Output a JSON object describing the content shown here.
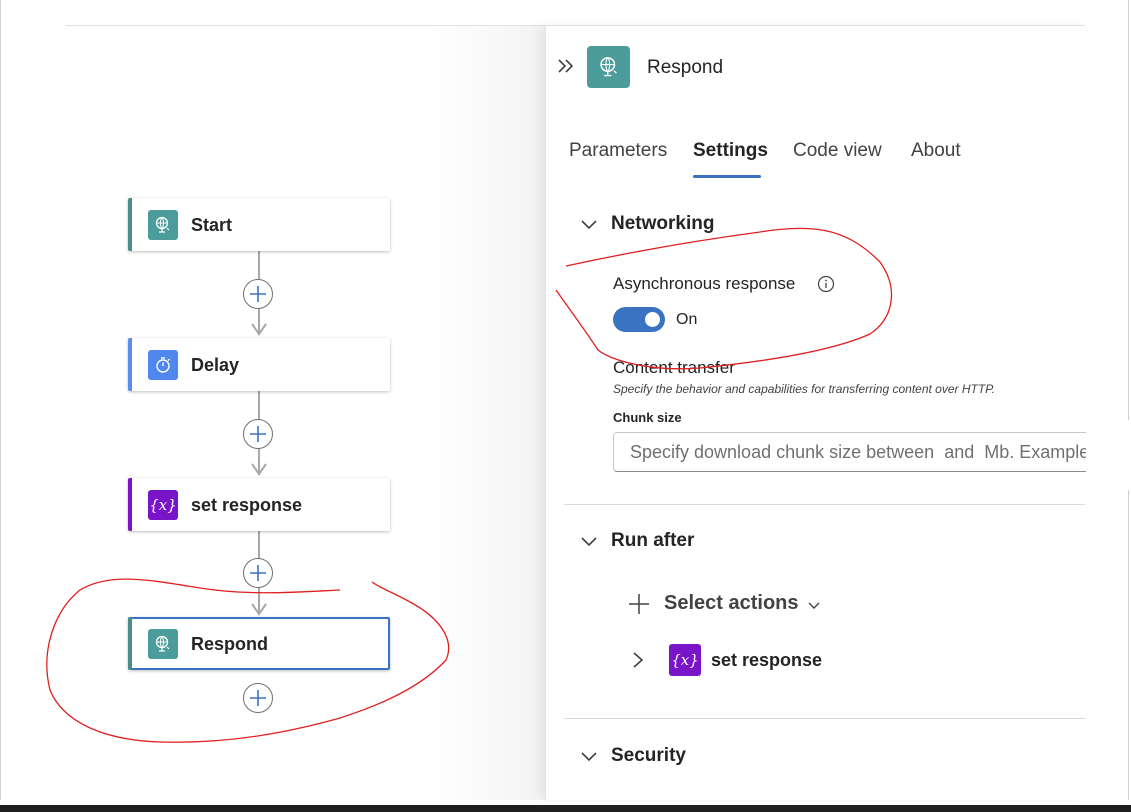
{
  "canvas": {
    "nodes": [
      {
        "label": "Start",
        "icon": "globe-request-icon",
        "accent": "#4b8c8b"
      },
      {
        "label": "Delay",
        "icon": "timer-icon",
        "accent": "#5b8def"
      },
      {
        "label": "set response",
        "icon": "variable-icon",
        "accent": "#7a14c8"
      },
      {
        "label": "Respond",
        "icon": "globe-request-icon",
        "accent": "#4b8c8b",
        "selected": true
      }
    ]
  },
  "panel": {
    "title": "Respond",
    "tabs": [
      {
        "label": "Parameters"
      },
      {
        "label": "Settings",
        "active": true
      },
      {
        "label": "Code view"
      },
      {
        "label": "About"
      }
    ],
    "networking": {
      "heading": "Networking",
      "async_label": "Asynchronous response",
      "toggle_state": "On",
      "content_transfer_title": "Content transfer",
      "content_transfer_desc": "Specify the behavior and capabilities for transferring content over HTTP.",
      "chunk_label": "Chunk size",
      "chunk_placeholder": "Specify download chunk size between  and  Mb. Example"
    },
    "run_after": {
      "heading": "Run after",
      "select_label": "Select actions",
      "action_label": "set response",
      "action_icon_text": "{x}"
    },
    "security": {
      "heading": "Security"
    }
  },
  "colors": {
    "accent": "#3b73c3",
    "annotation": "#e02020",
    "teal": "#4b9c9b",
    "purple": "#7a14c8"
  }
}
